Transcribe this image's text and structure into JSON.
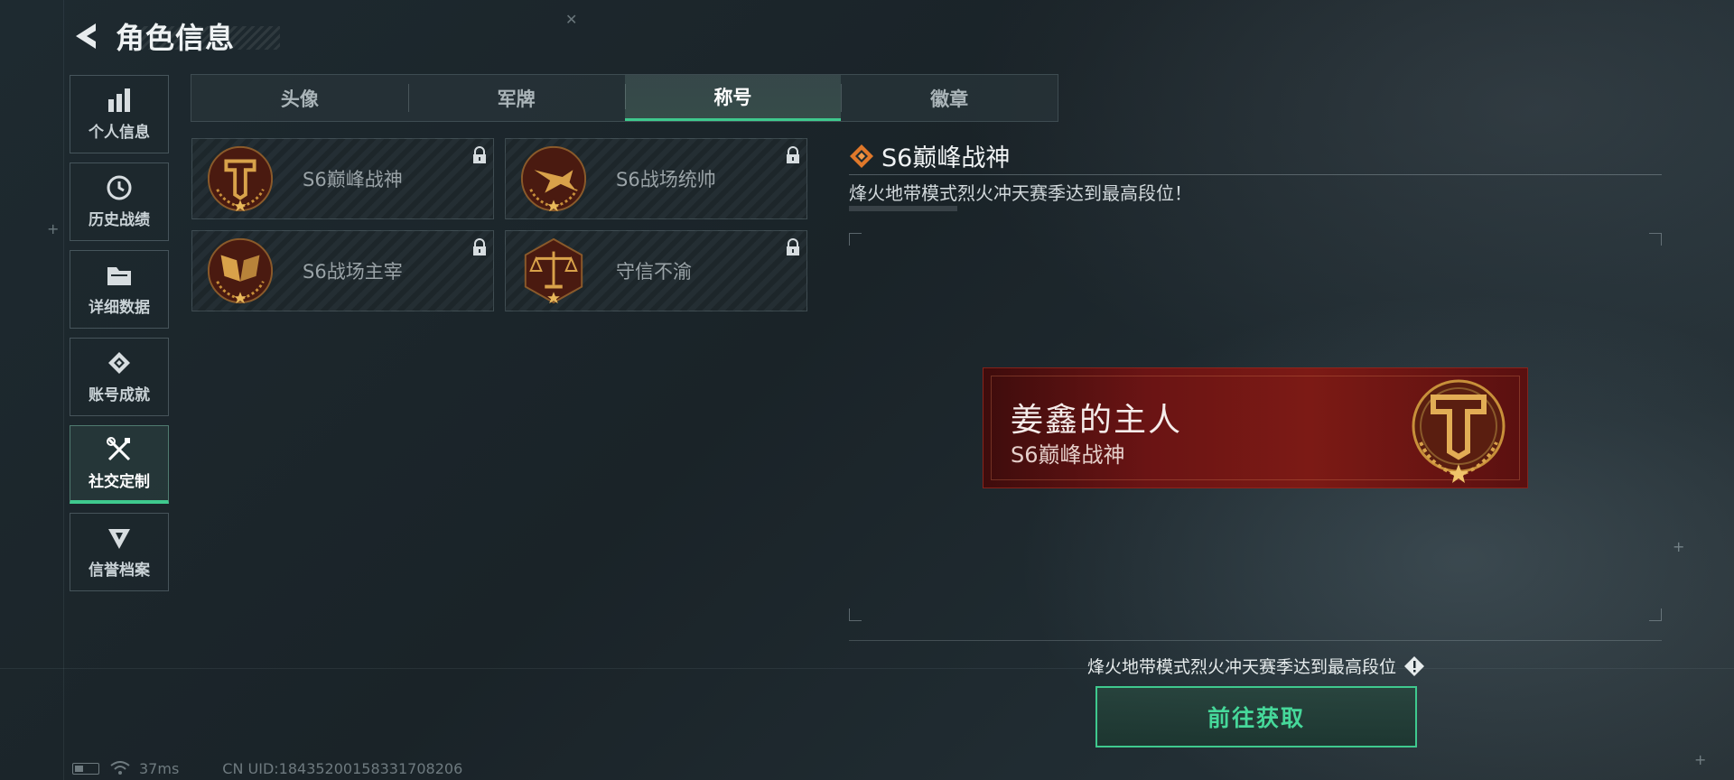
{
  "header": {
    "title": "角色信息"
  },
  "sidebar": {
    "items": [
      {
        "label": "个人信息",
        "icon": "bar-chart-icon"
      },
      {
        "label": "历史战绩",
        "icon": "clock-icon"
      },
      {
        "label": "详细数据",
        "icon": "folder-icon"
      },
      {
        "label": "账号成就",
        "icon": "achievement-icon"
      },
      {
        "label": "社交定制",
        "icon": "tools-icon",
        "active": true
      },
      {
        "label": "信誉档案",
        "icon": "shield-icon"
      }
    ]
  },
  "tabs": [
    {
      "label": "头像"
    },
    {
      "label": "军牌"
    },
    {
      "label": "称号",
      "active": true
    },
    {
      "label": "徽章"
    }
  ],
  "cards": [
    {
      "name": "S6巅峰战神",
      "emblem": "t-emblem-icon",
      "locked": true
    },
    {
      "name": "S6战场统帅",
      "emblem": "jet-emblem-icon",
      "locked": true
    },
    {
      "name": "S6战场主宰",
      "emblem": "flags-emblem-icon",
      "locked": true
    },
    {
      "name": "守信不渝",
      "emblem": "scale-emblem-icon",
      "locked": true
    }
  ],
  "detail": {
    "title": "S6巅峰战神",
    "description": "烽火地带模式烈火冲天赛季达到最高段位！",
    "preview": {
      "player_name": "姜鑫的主人",
      "title": "S6巅峰战神"
    },
    "requirement": "烽火地带模式烈火冲天赛季达到最高段位",
    "obtain_button": "前往获取"
  },
  "status": {
    "ping": "37ms",
    "uid": "CN UID:18435200158331708206"
  },
  "colors": {
    "accent": "#3fc98e",
    "banner": "#6a1414",
    "emblem_gold": "#c8903a"
  }
}
